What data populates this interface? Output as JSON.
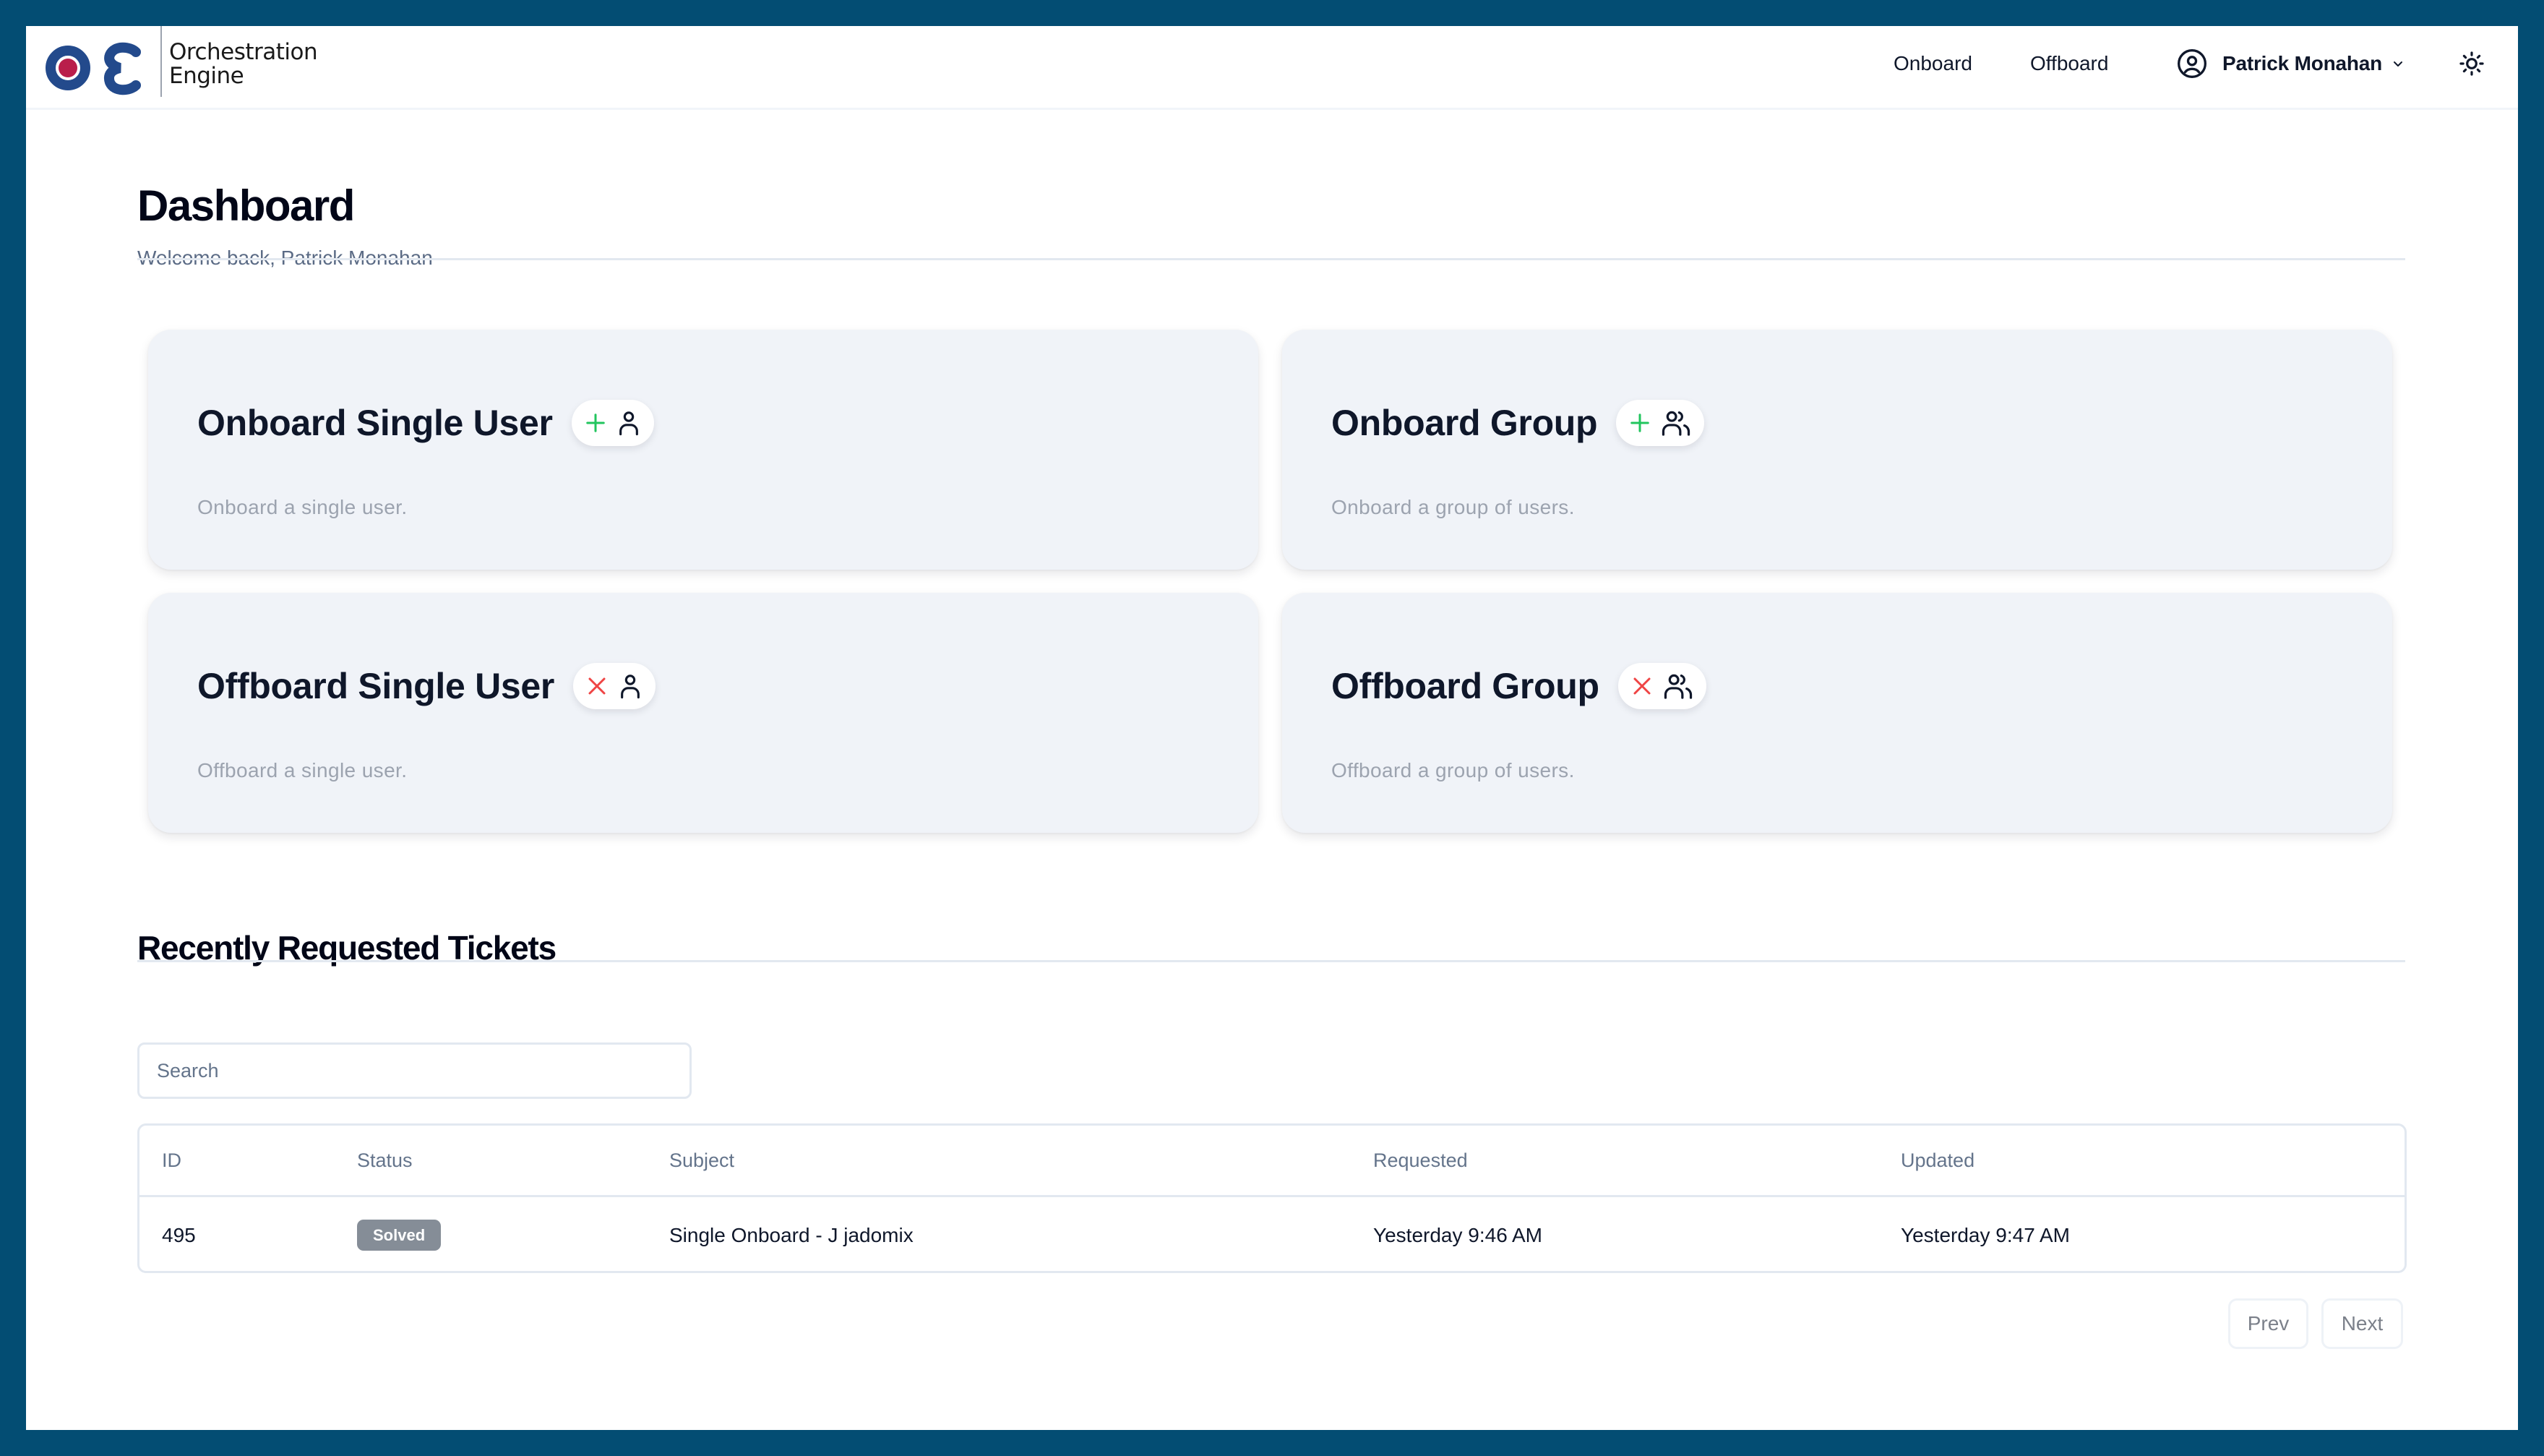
{
  "app": {
    "logo_line1": "Orchestration",
    "logo_line2": "Engine",
    "brand_colors": {
      "blue": "#234a8c",
      "red": "#b91e4b",
      "frame": "#034d73"
    }
  },
  "header": {
    "nav": [
      {
        "label": "Onboard"
      },
      {
        "label": "Offboard"
      }
    ],
    "user": {
      "name": "Patrick Monahan",
      "icon": "user-circle-icon"
    },
    "theme_toggle_icon": "sun-icon"
  },
  "page": {
    "title": "Dashboard",
    "subtitle": "Welcome back, Patrick Monahan"
  },
  "cards": [
    {
      "title": "Onboard Single User",
      "description": "Onboard a single user.",
      "action_icon": "plus-icon",
      "subject_icon": "user-icon",
      "action_color": "#22c55e"
    },
    {
      "title": "Onboard Group",
      "description": "Onboard a group of users.",
      "action_icon": "plus-icon",
      "subject_icon": "users-icon",
      "action_color": "#22c55e"
    },
    {
      "title": "Offboard Single User",
      "description": "Offboard a single user.",
      "action_icon": "x-icon",
      "subject_icon": "user-icon",
      "action_color": "#ef4444"
    },
    {
      "title": "Offboard Group",
      "description": "Offboard a group of users.",
      "action_icon": "x-icon",
      "subject_icon": "users-icon",
      "action_color": "#ef4444"
    }
  ],
  "tickets": {
    "title": "Recently Requested Tickets",
    "search": {
      "placeholder": "Search",
      "value": ""
    },
    "columns": [
      "ID",
      "Status",
      "Subject",
      "Requested",
      "Updated"
    ],
    "rows": [
      {
        "id": "495",
        "status": "Solved",
        "subject": "Single Onboard - J jadomix",
        "requested": "Yesterday 9:46 AM",
        "updated": "Yesterday 9:47 AM"
      }
    ],
    "pagination": {
      "prev_label": "Prev",
      "next_label": "Next"
    }
  }
}
